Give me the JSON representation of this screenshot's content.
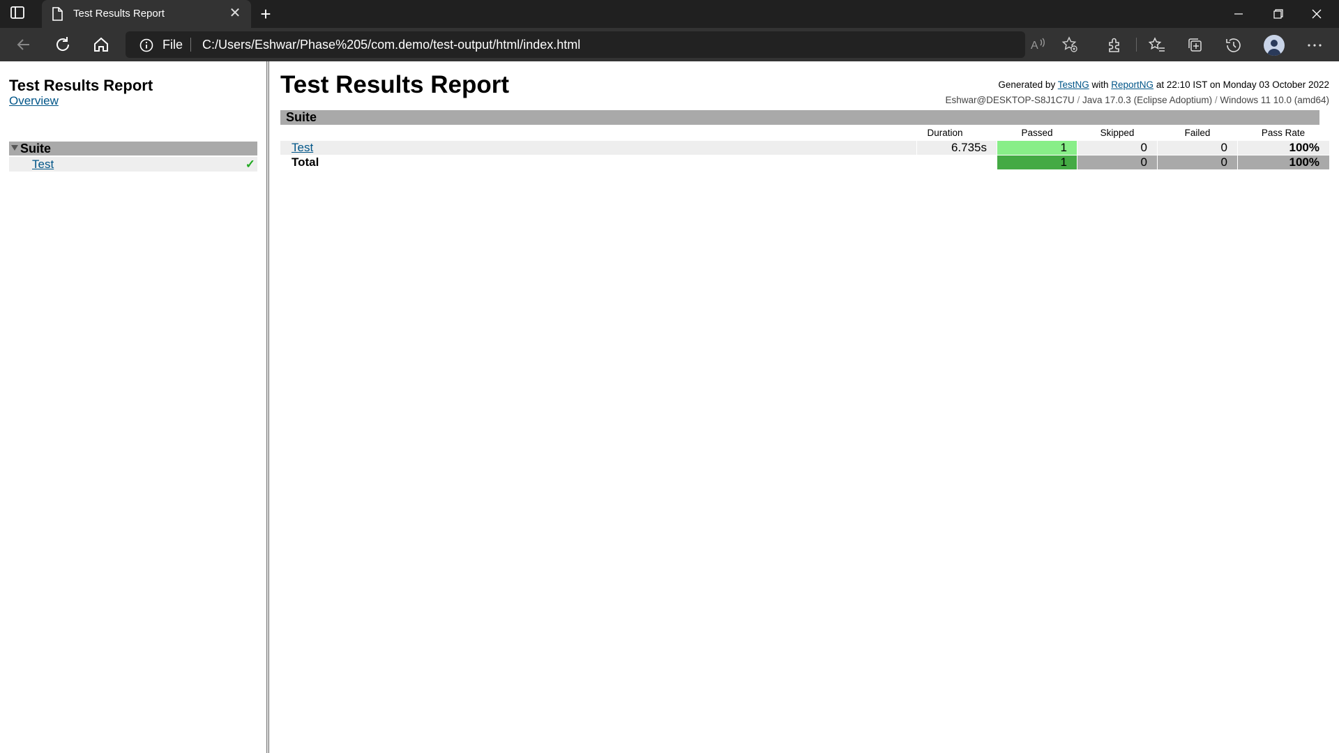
{
  "browser": {
    "tab_title": "Test Results Report",
    "address_scheme": "File",
    "address_url": "C:/Users/Eshwar/Phase%205/com.demo/test-output/html/index.html"
  },
  "nav": {
    "title": "Test Results Report",
    "overview_label": "Overview",
    "suite_label": "Suite",
    "test_label": "Test",
    "test_status": "✓"
  },
  "header": {
    "title": "Test Results Report",
    "generated_prefix": "Generated by",
    "testng_label": "TestNG",
    "with_label": "with",
    "reportng_label": "ReportNG",
    "generated_suffix": "at 22:10 IST on Monday 03 October 2022",
    "host": "Eshwar@DESKTOP-S8J1C7U",
    "java": "Java 17.0.3 (Eclipse Adoptium)",
    "os": "Windows 11 10.0 (amd64)",
    "separator": "/"
  },
  "suite": {
    "name": "Suite",
    "columns": [
      "Duration",
      "Passed",
      "Skipped",
      "Failed",
      "Pass Rate"
    ],
    "rows": [
      {
        "name": "Test",
        "duration": "6.735s",
        "passed": "1",
        "skipped": "0",
        "failed": "0",
        "pass_rate": "100%"
      }
    ],
    "total": {
      "label": "Total",
      "passed": "1",
      "skipped": "0",
      "failed": "0",
      "pass_rate": "100%"
    }
  },
  "colors": {
    "passed_row": "#88ee88",
    "passed_total": "#44aa44",
    "neutral_total": "#a9a9a9",
    "row_bg": "#eeeeee",
    "link": "#005588"
  }
}
